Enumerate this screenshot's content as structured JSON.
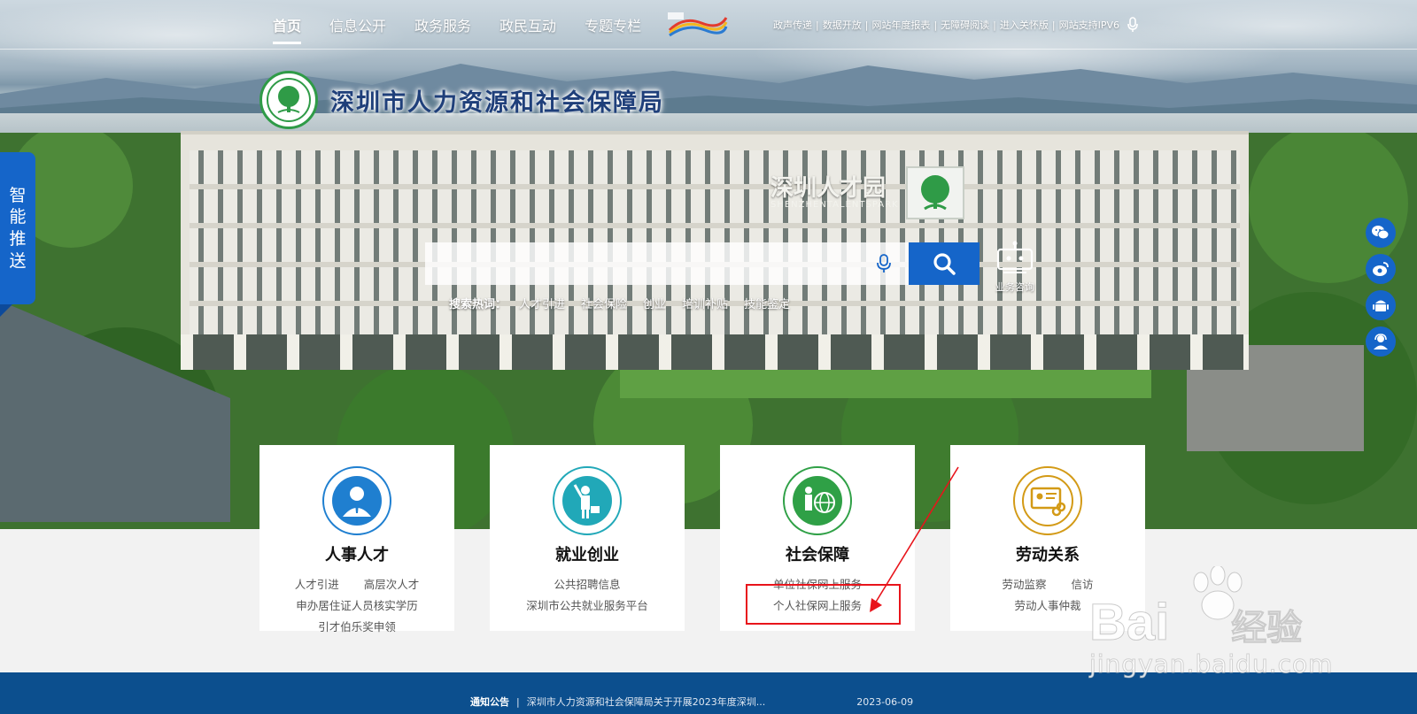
{
  "nav": {
    "items": [
      {
        "label": "首页",
        "active": true
      },
      {
        "label": "信息公开",
        "active": false
      },
      {
        "label": "政务服务",
        "active": false
      },
      {
        "label": "政民互动",
        "active": false
      },
      {
        "label": "专题专栏",
        "active": false
      }
    ]
  },
  "util_links": [
    "政声传递",
    "数据开放",
    "网站年度报表",
    "无障碍阅读",
    "进入关怀版",
    "网站支持IPV6"
  ],
  "site": {
    "title": "深圳市人力资源和社会保障局",
    "park_sign": "深圳人才园",
    "park_sign_en": "SHENZHENTALENTSPARK"
  },
  "search": {
    "placeholder": "",
    "hot_label": "搜索热词：",
    "hot_words": [
      "人才引进",
      "社会保险",
      "创业",
      "培训补贴",
      "技能鉴定"
    ],
    "consult_label": "业务咨询"
  },
  "left_tab": {
    "chars": [
      "智",
      "能",
      "推",
      "送"
    ]
  },
  "right_icons": [
    "wechat-icon",
    "weibo-icon",
    "android-icon",
    "customer-service-icon"
  ],
  "cards": [
    {
      "title": "人事人才",
      "color": "#1f7fd0",
      "rows": [
        [
          "人才引进",
          "高层次人才"
        ],
        [
          "申办居住证人员核实学历"
        ],
        [
          "引才伯乐奖申领"
        ]
      ]
    },
    {
      "title": "就业创业",
      "color": "#21a8b8",
      "rows": [
        [
          "公共招聘信息"
        ],
        [
          "深圳市公共就业服务平台"
        ]
      ]
    },
    {
      "title": "社会保障",
      "color": "#2fa046",
      "rows": [
        [
          "单位社保网上服务"
        ],
        [
          "个人社保网上服务"
        ]
      ]
    },
    {
      "title": "劳动关系",
      "color": "#d39a16",
      "rows": [
        [
          "劳动监察",
          "信访"
        ],
        [
          "劳动人事仲裁"
        ]
      ]
    }
  ],
  "notice": {
    "label": "通知公告",
    "text": "深圳市人力资源和社会保障局关于开展2023年度深圳...",
    "date": "2023-06-09"
  },
  "watermark": {
    "main": "Bai",
    "main2": "经验",
    "sub": "jingyan.baidu.com"
  },
  "colors": {
    "primary": "#1565c9",
    "notice_bg": "#0c4f8e",
    "highlight": "#e8141b"
  }
}
